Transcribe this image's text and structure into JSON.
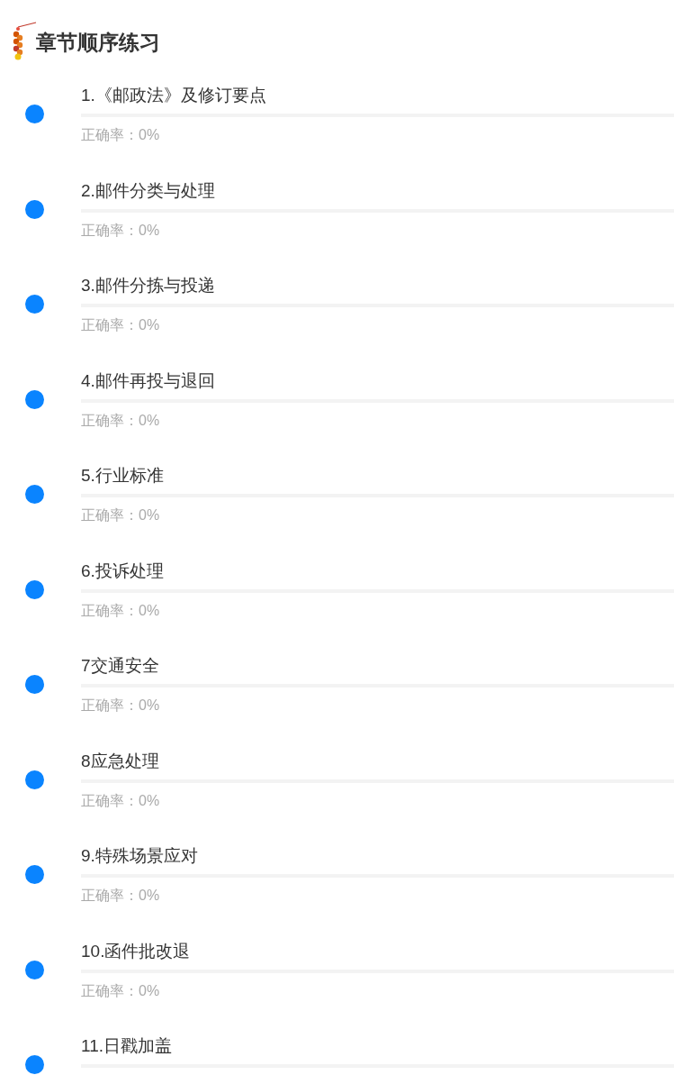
{
  "header": {
    "title": "章节顺序练习"
  },
  "chapters": [
    {
      "title": "1.《邮政法》及修订要点",
      "accuracy": "正确率：0%"
    },
    {
      "title": "2.邮件分类与处理",
      "accuracy": "正确率：0%"
    },
    {
      "title": "3.邮件分拣与投递",
      "accuracy": "正确率：0%"
    },
    {
      "title": "4.邮件再投与退回",
      "accuracy": "正确率：0%"
    },
    {
      "title": "5.行业标准",
      "accuracy": "正确率：0%"
    },
    {
      "title": "6.投诉处理",
      "accuracy": "正确率：0%"
    },
    {
      "title": "7交通安全",
      "accuracy": "正确率：0%"
    },
    {
      "title": "8应急处理",
      "accuracy": "正确率：0%"
    },
    {
      "title": "9.特殊场景应对",
      "accuracy": "正确率：0%"
    },
    {
      "title": "10.函件批改退",
      "accuracy": "正确率：0%"
    },
    {
      "title": "11.日戳加盖"
    }
  ]
}
